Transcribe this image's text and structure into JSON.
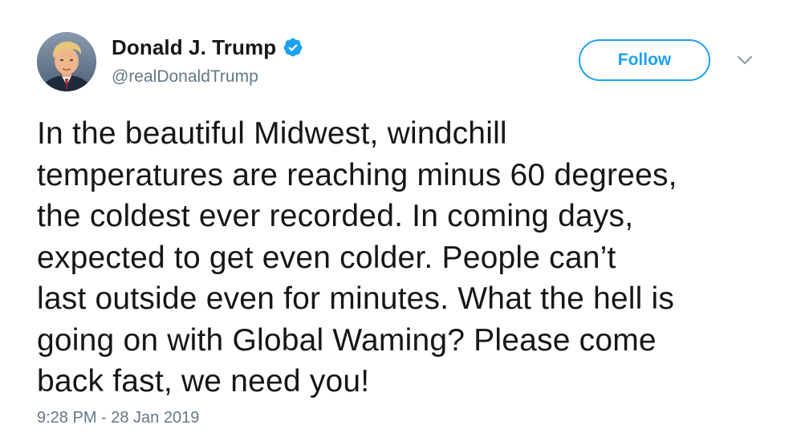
{
  "user": {
    "display_name": "Donald J. Trump",
    "handle": "@realDonaldTrump",
    "verified": true,
    "avatar_icon": "profile-photo"
  },
  "actions": {
    "follow_label": "Follow",
    "menu_icon": "chevron-down-icon"
  },
  "tweet": {
    "lines": [
      "In the beautiful Midwest, windchill",
      "temperatures are reaching minus 60 degrees,",
      "the coldest ever recorded. In coming days,",
      "expected to get even colder. People can’t",
      "last outside even for minutes. What the hell is",
      "going on with Global Waming? Please come",
      "back fast, we need you!"
    ]
  },
  "meta": {
    "timestamp": "9:28 PM - 28 Jan 2019"
  },
  "colors": {
    "brand_blue": "#1da1f2",
    "text_primary": "#14171a",
    "text_secondary": "#657786",
    "background": "#ffffff"
  }
}
